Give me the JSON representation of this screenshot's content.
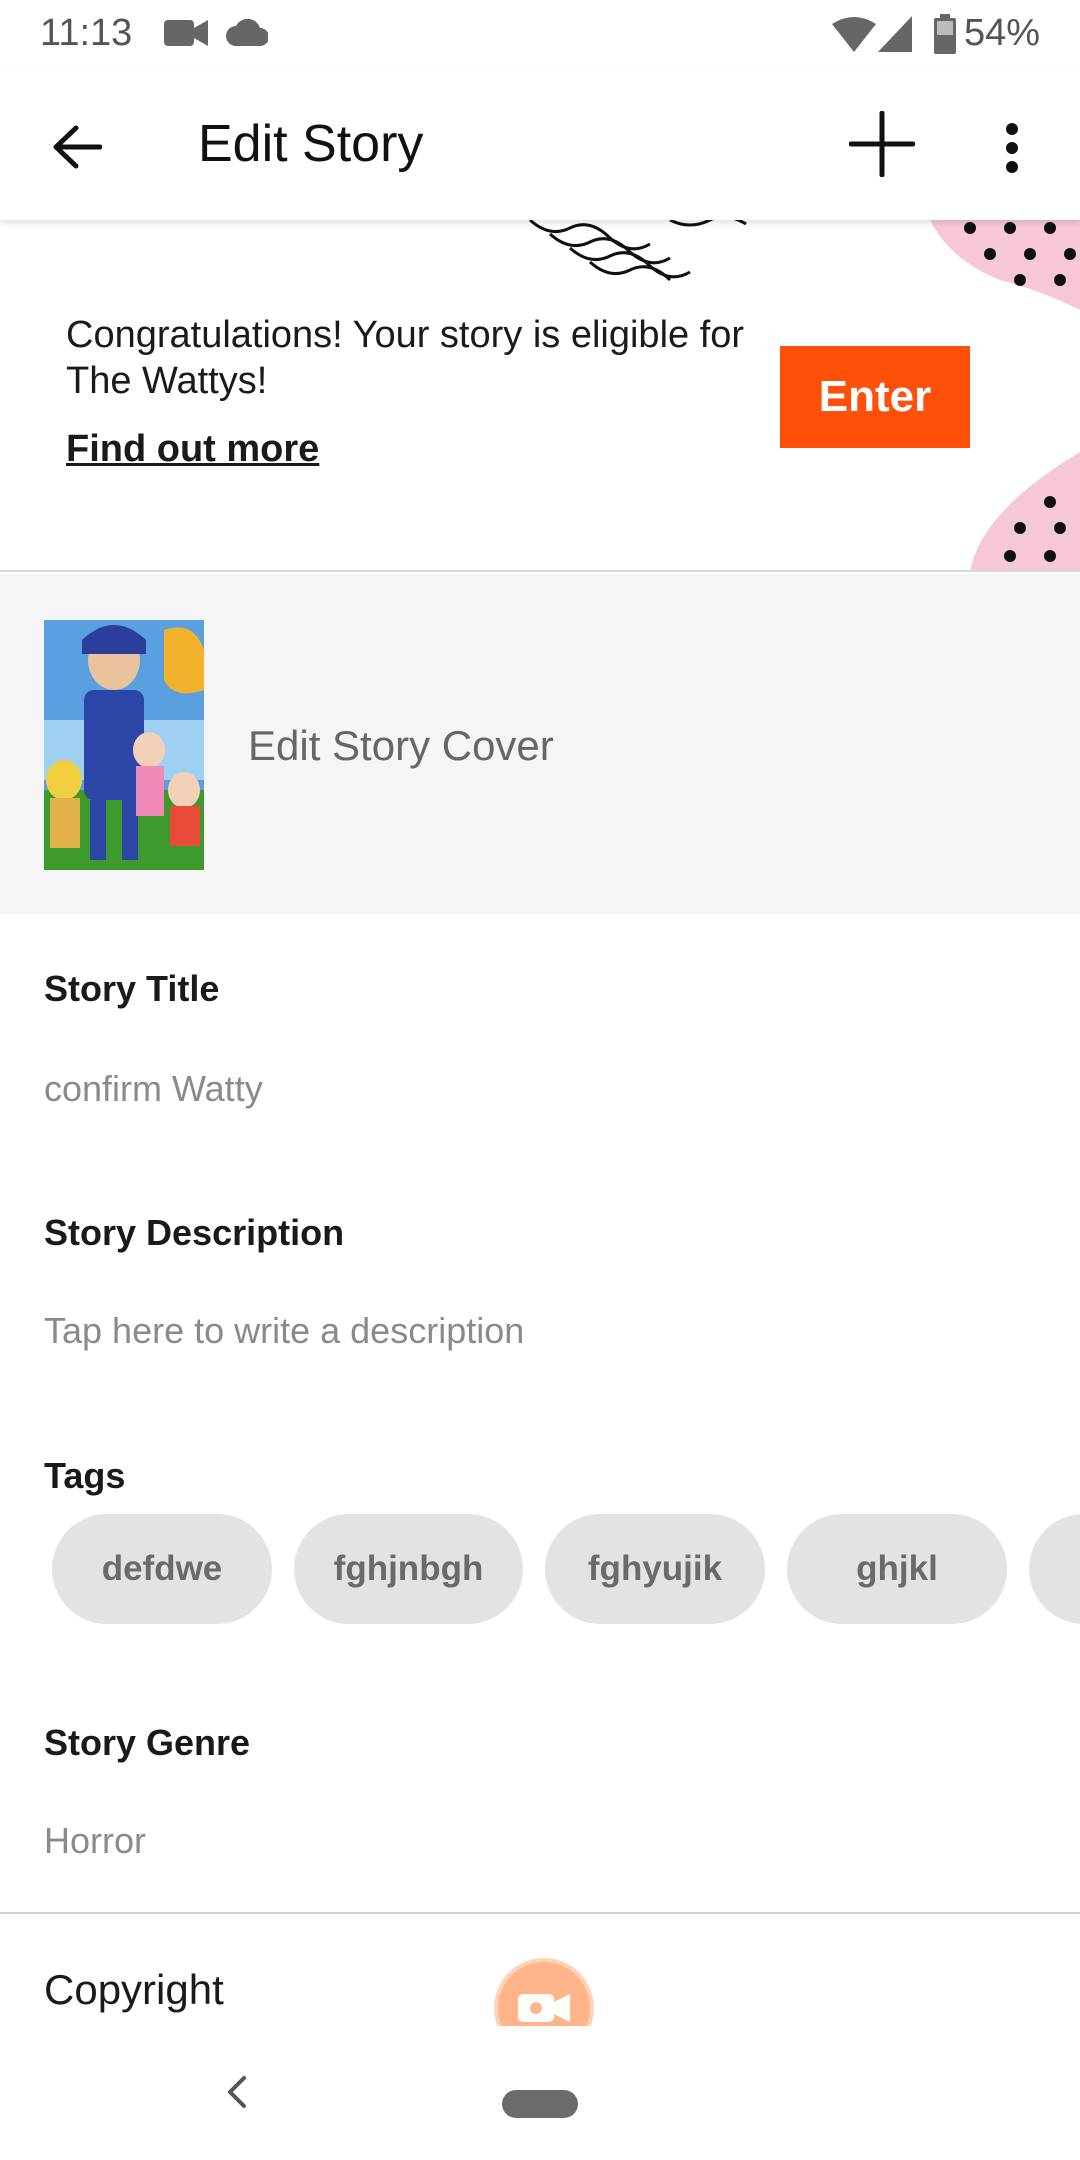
{
  "status_bar": {
    "time": "11:13",
    "battery": "54%"
  },
  "app_bar": {
    "title": "Edit Story"
  },
  "banner": {
    "text": "Congratulations! Your story is eligible for The Wattys!",
    "link": "Find out more",
    "button": "Enter",
    "accent_color": "#ff500a"
  },
  "cover": {
    "label": "Edit Story Cover"
  },
  "story_title": {
    "label": "Story Title",
    "value": "confirm Watty"
  },
  "story_description": {
    "label": "Story Description",
    "placeholder": "Tap here to write a description"
  },
  "tags": {
    "label": "Tags",
    "items": [
      "defdwe",
      "fghjnbgh",
      "fghyujik",
      "ghjkl"
    ]
  },
  "story_genre": {
    "label": "Story Genre",
    "value": "Horror"
  },
  "copyright": {
    "label": "Copyright"
  }
}
